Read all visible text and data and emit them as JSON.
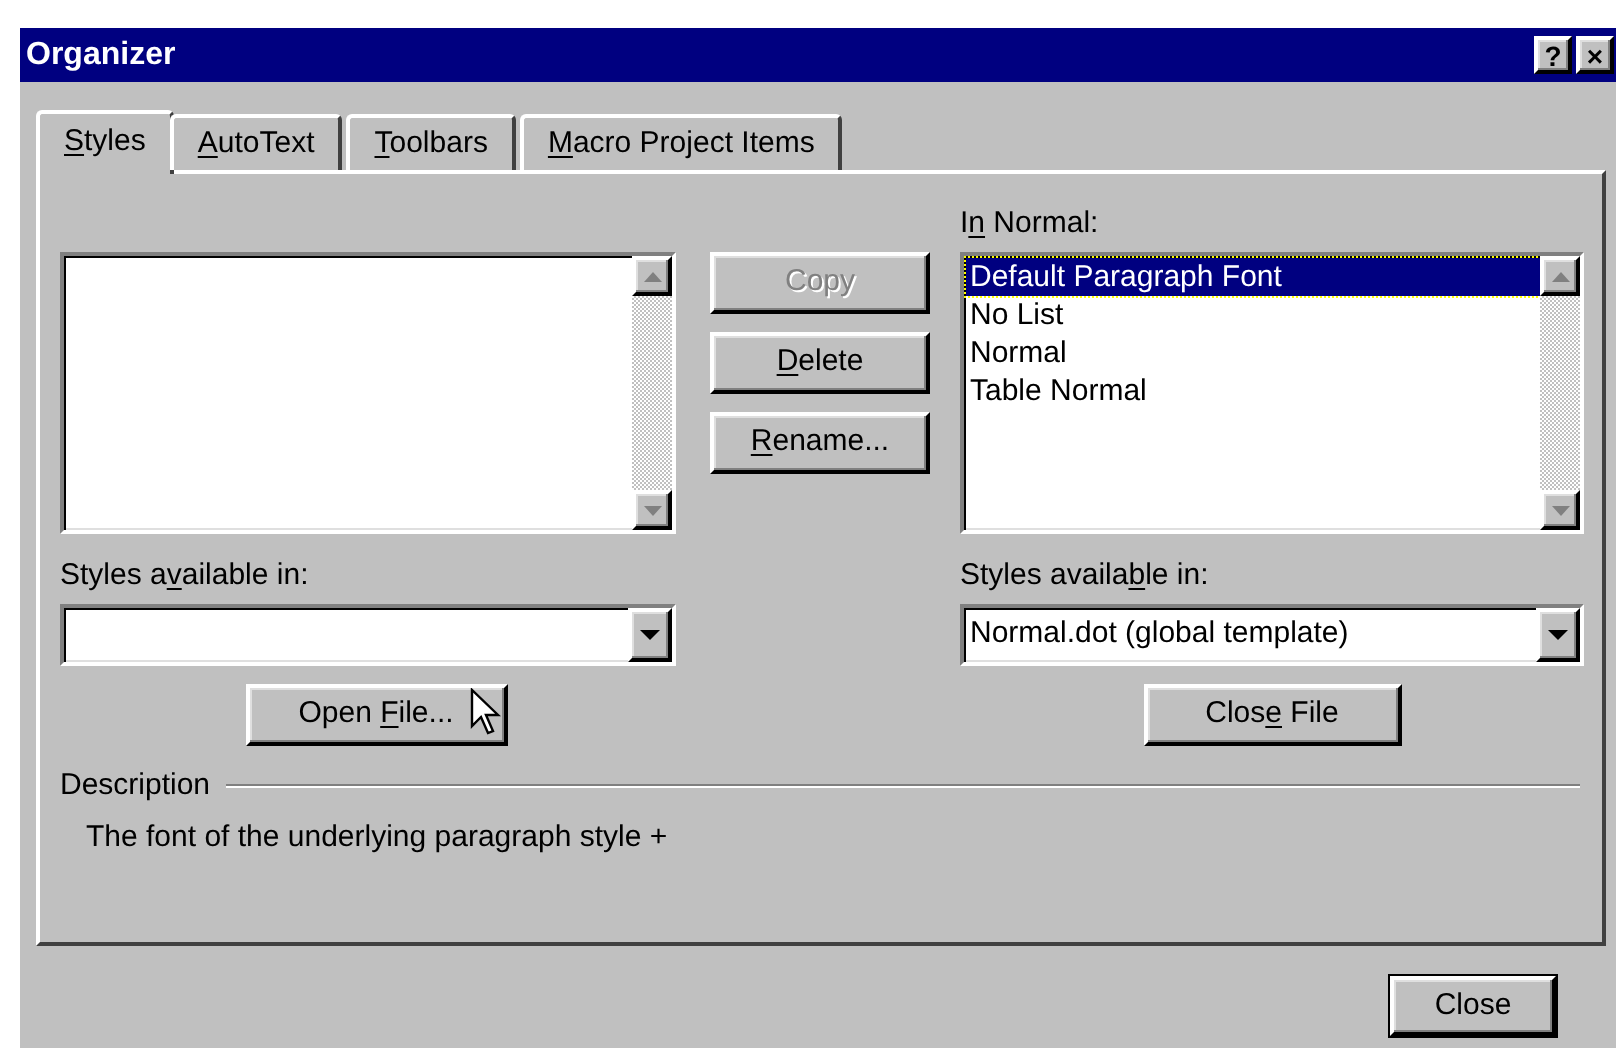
{
  "window": {
    "title": "Organizer",
    "title_buttons": [
      "?",
      "×"
    ]
  },
  "tabs": [
    {
      "hotkey": "S",
      "post": "tyles",
      "selected": true
    },
    {
      "hotkey": "A",
      "post": "utoText",
      "selected": false
    },
    {
      "hotkey": "T",
      "post": "oolbars",
      "selected": false
    },
    {
      "hotkey": "M",
      "post": "acro Project Items",
      "selected": false
    }
  ],
  "left_pane": {
    "available_label": {
      "pre": "Styles a",
      "hotkey": "v",
      "post": "ailable in:"
    },
    "file_button": {
      "pre": "Open ",
      "hotkey": "F",
      "post": "ile..."
    }
  },
  "actions": [
    {
      "post": "Copy",
      "disabled": true
    },
    {
      "hotkey": "D",
      "post": "elete",
      "disabled": false
    },
    {
      "hotkey": "R",
      "post": "ename...",
      "disabled": false
    }
  ],
  "right_pane": {
    "list_label": {
      "pre": "I",
      "hotkey": "n",
      "post": " Normal:"
    },
    "items": [
      {
        "text": "Default Paragraph Font",
        "selected": true
      },
      {
        "text": "No List",
        "selected": false
      },
      {
        "text": "Normal",
        "selected": false
      },
      {
        "text": "Table Normal",
        "selected": false
      }
    ],
    "available_label": {
      "pre": "Styles availa",
      "hotkey": "b",
      "post": "le in:"
    },
    "combo_value": "Normal.dot (global template)",
    "file_button": {
      "pre": "Clos",
      "hotkey": "e",
      "post": " File"
    }
  },
  "description": {
    "label": "Description",
    "text": "The font of the underlying paragraph style +"
  },
  "close_button": "Close"
}
